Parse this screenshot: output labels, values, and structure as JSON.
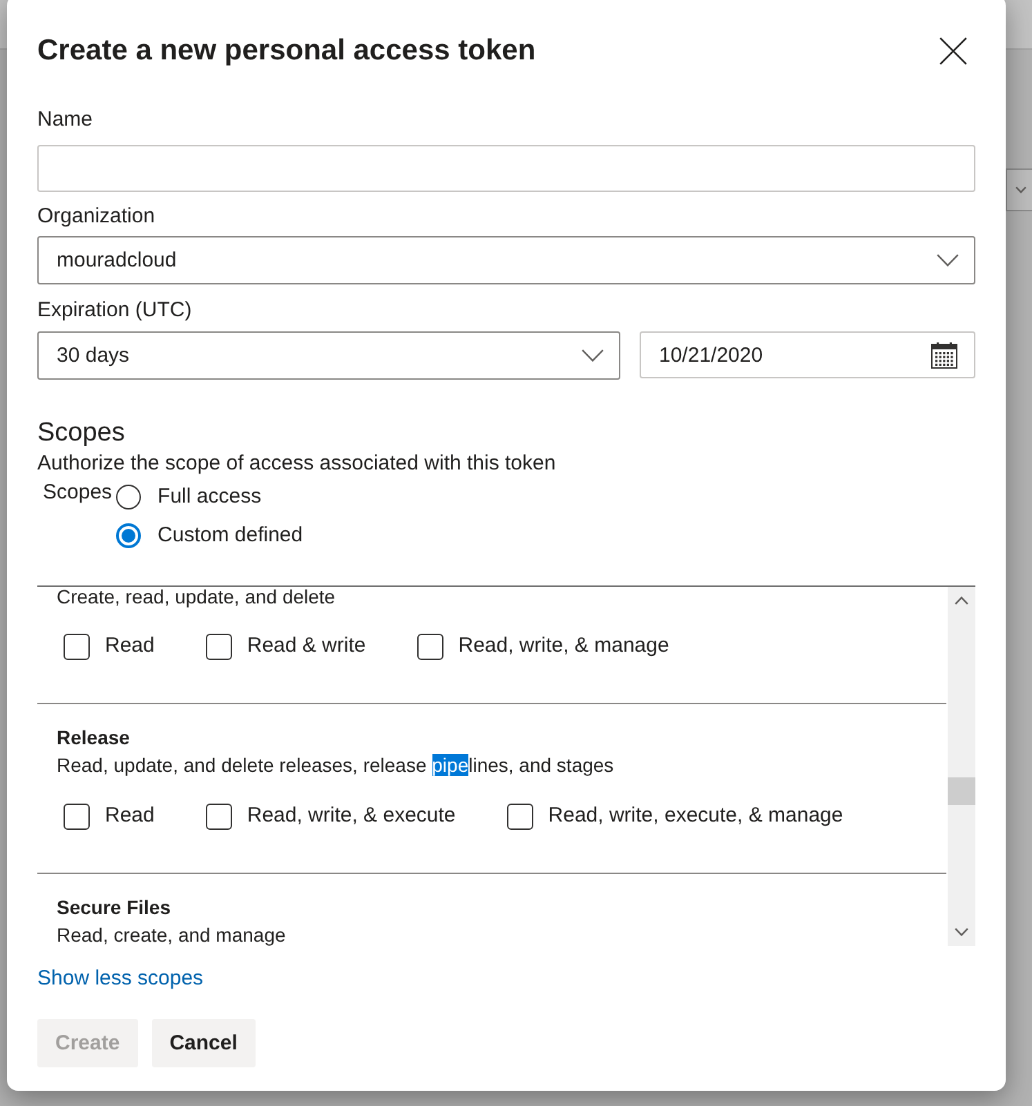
{
  "title": "Create a new personal access token",
  "name_field": {
    "label": "Name"
  },
  "organization_field": {
    "label": "Organization",
    "value": "mouradcloud"
  },
  "expiration": {
    "label": "Expiration (UTC)",
    "duration": "30 days",
    "date": "10/21/2020"
  },
  "scopes": {
    "heading": "Scopes",
    "description": "Authorize the scope of access associated with this token",
    "group_label": "Scopes",
    "options": [
      {
        "label": "Full access",
        "selected": false
      },
      {
        "label": "Custom defined",
        "selected": true
      }
    ]
  },
  "scope_list": {
    "items": [
      {
        "description": [
          {
            "text": "Create, read, update, and delete",
            "selected": false
          }
        ],
        "permissions": [
          {
            "label": "Read",
            "checked": false
          },
          {
            "label": "Read & write",
            "checked": false
          },
          {
            "label": "Read, write, & manage",
            "checked": false
          }
        ]
      },
      {
        "title": "Release",
        "description": [
          {
            "text": "Read, update, and delete releases, release ",
            "selected": false
          },
          {
            "text": "pipe",
            "selected": true
          },
          {
            "text": "lines, and stages",
            "selected": false
          }
        ],
        "permissions": [
          {
            "label": "Read",
            "checked": false
          },
          {
            "label": "Read, write, & execute",
            "checked": false
          },
          {
            "label": "Read, write, execute, & manage",
            "checked": false
          }
        ]
      },
      {
        "title": "Secure Files",
        "description": [
          {
            "text": "Read, create, and manage",
            "selected": false
          }
        ]
      }
    ]
  },
  "toggle_link": "Show less scopes",
  "buttons": [
    {
      "label": "Create",
      "disabled": true
    },
    {
      "label": "Cancel",
      "disabled": false
    }
  ]
}
